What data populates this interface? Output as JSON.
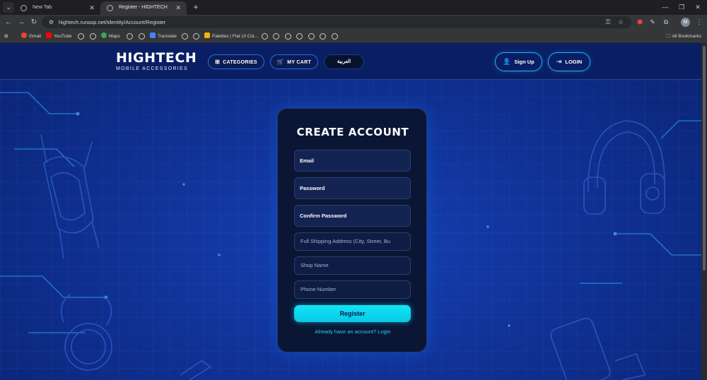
{
  "browser": {
    "tabs": [
      {
        "title": "New Tab",
        "active": false
      },
      {
        "title": "Register - HIGHTECH",
        "active": true
      }
    ],
    "url": "hightech.runasp.net/Identity/Account/Register",
    "profile_initial": "M",
    "bookmarks": [
      {
        "label": "Gmail",
        "color": "#ea4335"
      },
      {
        "label": "YouTube",
        "color": "#ff0000"
      },
      {
        "label": "Maps",
        "color": "#34a853"
      },
      {
        "label": "Translate",
        "color": "#4285f4"
      },
      {
        "label": "Palettes | Flat UI Col...",
        "color": "#f4b400"
      }
    ],
    "all_bookmarks": "All Bookmarks"
  },
  "site": {
    "logo_main": "HIGHTECH",
    "logo_sub": "MOBILE ACCESSORIES",
    "nav": {
      "categories": "CATEGORIES",
      "cart": "MY CART",
      "language": "العربية"
    },
    "auth": {
      "signup": "Sign Up",
      "login": "LOGIN"
    }
  },
  "form": {
    "title": "CREATE ACCOUNT",
    "email": "Email",
    "password": "Password",
    "confirm_password": "Confirm Password",
    "address_placeholder": "Full Shipping Address (City, Street, Bu",
    "shop_placeholder": "Shop Name",
    "phone_placeholder": "Phone Number",
    "register": "Register",
    "login_link": "Already have an account? Login"
  },
  "colors": {
    "accent": "#12e5f5",
    "header_bg": "#0a1f63",
    "card_bg": "#0b1635",
    "link": "#22d3ee"
  }
}
